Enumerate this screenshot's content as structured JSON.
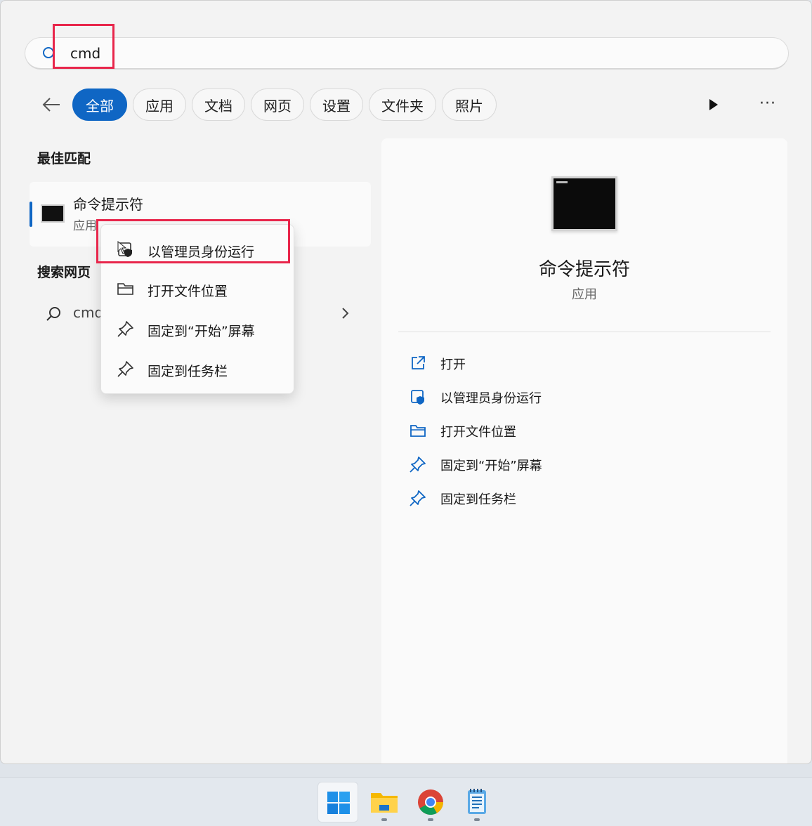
{
  "search": {
    "value": "cmd"
  },
  "filters": {
    "tabs": [
      {
        "label": "全部",
        "active": true
      },
      {
        "label": "应用",
        "active": false
      },
      {
        "label": "文档",
        "active": false
      },
      {
        "label": "网页",
        "active": false
      },
      {
        "label": "设置",
        "active": false
      },
      {
        "label": "文件夹",
        "active": false
      },
      {
        "label": "照片",
        "active": false
      }
    ],
    "more": "···"
  },
  "best_match": {
    "heading": "最佳匹配",
    "title": "命令提示符",
    "subtitle": "应用"
  },
  "web_search": {
    "heading": "搜索网页",
    "query": "cmd"
  },
  "context_menu": {
    "items": [
      {
        "label": "以管理员身份运行",
        "icon": "shield-icon",
        "highlighted": true
      },
      {
        "label": "打开文件位置",
        "icon": "folder-icon"
      },
      {
        "label": "固定到“开始”屏幕",
        "icon": "pin-icon"
      },
      {
        "label": "固定到任务栏",
        "icon": "pin-icon"
      }
    ]
  },
  "preview": {
    "title": "命令提示符",
    "subtitle": "应用",
    "actions": [
      {
        "label": "打开",
        "icon": "open-external-icon"
      },
      {
        "label": "以管理员身份运行",
        "icon": "shield-icon"
      },
      {
        "label": "打开文件位置",
        "icon": "folder-icon"
      },
      {
        "label": "固定到“开始”屏幕",
        "icon": "pin-icon"
      },
      {
        "label": "固定到任务栏",
        "icon": "pin-icon"
      }
    ]
  },
  "taskbar": {
    "apps": [
      {
        "icon": "windows-start-icon"
      },
      {
        "icon": "file-explorer-icon"
      },
      {
        "icon": "chrome-icon"
      },
      {
        "icon": "notepad-icon"
      }
    ]
  },
  "colors": {
    "accent": "#0f66c4",
    "highlight_box": "#e8264b"
  }
}
